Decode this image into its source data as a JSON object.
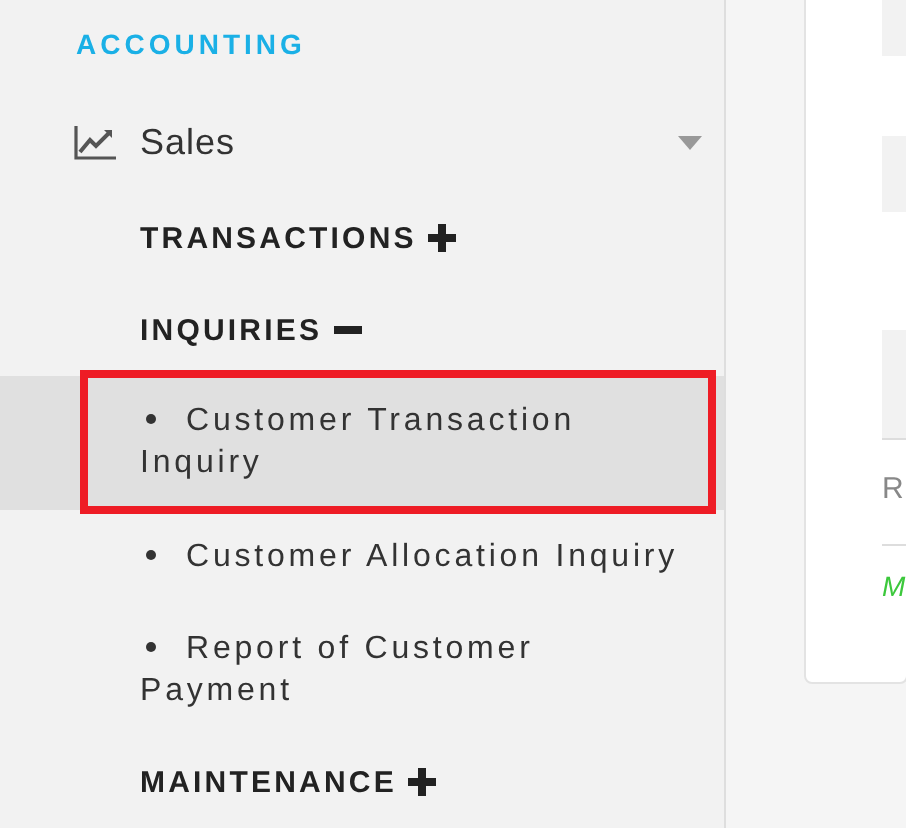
{
  "sidebar": {
    "section": "ACCOUNTING",
    "menu": {
      "label": "Sales",
      "expanded": true,
      "groups": [
        {
          "label": "TRANSACTIONS",
          "expanded": false
        },
        {
          "label": "INQUIRIES",
          "expanded": true,
          "items": [
            {
              "label": "Customer Transaction Inquiry",
              "selected": true,
              "annotated": true
            },
            {
              "label": "Customer Allocation Inquiry",
              "selected": false,
              "annotated": false
            },
            {
              "label": "Report of Customer Payment",
              "selected": false,
              "annotated": false
            }
          ]
        },
        {
          "label": "MAINTENANCE",
          "expanded": false
        }
      ]
    }
  },
  "content": {
    "rows": [
      {
        "kind": "stripe"
      },
      {
        "kind": "blank"
      },
      {
        "kind": "stripe"
      },
      {
        "kind": "blank"
      },
      {
        "kind": "stripe"
      },
      {
        "kind": "text",
        "text": "R"
      },
      {
        "kind": "note",
        "text": "M"
      }
    ]
  }
}
